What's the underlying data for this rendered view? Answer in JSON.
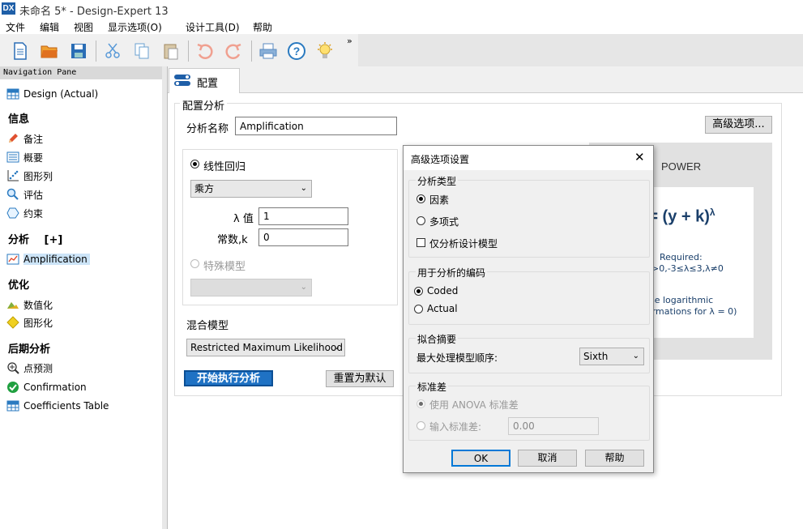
{
  "window": {
    "logo": "DX",
    "title": "未命名 5* - Design-Expert 13"
  },
  "menu": [
    "文件",
    "编辑",
    "视图",
    "显示选项(O)",
    "设计工具(D)",
    "帮助"
  ],
  "toolbar": {
    "more": "»",
    "icons": [
      "new-file-icon",
      "open-folder-icon",
      "save-icon",
      "cut-icon",
      "copy-icon",
      "paste-icon",
      "undo-icon",
      "redo-icon",
      "print-icon",
      "help-icon",
      "tip-bulb-icon"
    ]
  },
  "nav": {
    "header": "Navigation Pane",
    "design": "Design (Actual)",
    "info_head": "信息",
    "notes": "备注",
    "summary": "概要",
    "graph_columns": "图形列",
    "evaluation": "评估",
    "constraints": "约束",
    "analysis_head": "分析",
    "analysis_plus": "[+]",
    "amplification": "Amplification",
    "optimization_head": "优化",
    "numerical": "数值化",
    "graphical": "图形化",
    "post_head": "后期分析",
    "point_prediction": "点预测",
    "confirmation": "Confirmation",
    "coef_table": "Coefficients Table"
  },
  "tab": {
    "label": "配置"
  },
  "config": {
    "group_title": "配置分析",
    "name_label": "分析名称",
    "name_value": "Amplification",
    "advanced_button": "高级选项...",
    "linear_regression": "线性回归",
    "transform_value": "乘方",
    "lambda_label": "λ 值",
    "lambda_value": "1",
    "constant_label": "常数,k",
    "constant_value": "0",
    "special_model": "特殊模型",
    "mixed_model": "混合模型",
    "mixed_value": "Restricted Maximum Likelihood",
    "start_button": "开始执行分析",
    "reset_button": "重置为默认"
  },
  "power": {
    "title": "POWER",
    "formula": "' = (y + k)",
    "formula_sup": "λ",
    "req1": "Required:",
    "req2": ">0,-3≤λ≤3,λ≠0",
    "note1": "se logarithmic",
    "note2": "ormations for λ = 0)"
  },
  "dialog": {
    "title": "高级选项设置",
    "close": "✕",
    "analysis_type": "分析类型",
    "factor": "因素",
    "polynomial": "多项式",
    "design_model_only": "仅分析设计模型",
    "coding_title": "用于分析的编码",
    "coded": "Coded",
    "actual": "Actual",
    "fit_summary": "拟合摘要",
    "max_order_label": "最大处理模型顺序:",
    "max_order_value": "Sixth",
    "std_dev": "标准差",
    "use_anova": "使用 ANOVA 标准差",
    "input_std": "输入标准差:",
    "input_std_value": "0.00",
    "ok": "OK",
    "cancel": "取消",
    "help": "帮助"
  }
}
